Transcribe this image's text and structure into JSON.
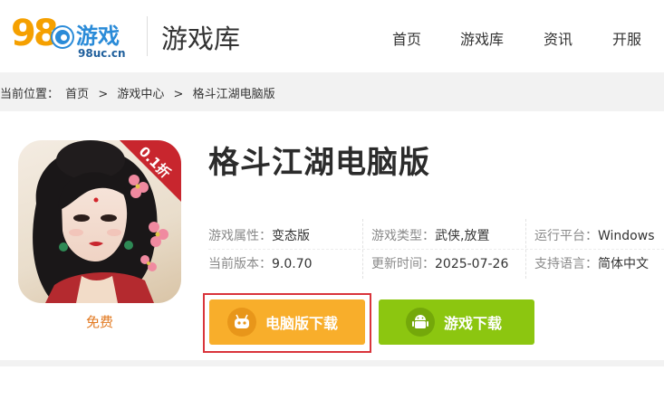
{
  "header": {
    "logo_number": "98",
    "logo_text": "游戏",
    "logo_url": "98uc.cn",
    "section_title": "游戏库",
    "nav": [
      "首页",
      "游戏库",
      "资讯",
      "开服"
    ]
  },
  "breadcrumb": {
    "prefix": "当前位置：",
    "items": [
      "首页",
      "游戏中心",
      "格斗江湖电脑版"
    ],
    "separator": ">"
  },
  "game": {
    "title": "格斗江湖电脑版",
    "badge": "0.1折",
    "price": "免费",
    "info": [
      {
        "label": "游戏属性：",
        "value": "变态版"
      },
      {
        "label": "游戏类型：",
        "value": "武侠,放置"
      },
      {
        "label": "运行平台：",
        "value": "Windows"
      },
      {
        "label": "当前版本：",
        "value": "9.0.70"
      },
      {
        "label": "更新时间：",
        "value": "2025-07-26"
      },
      {
        "label": "支持语言：",
        "value": "简体中文"
      }
    ]
  },
  "buttons": {
    "pc_download": "电脑版下载",
    "game_download": "游戏下载"
  },
  "colors": {
    "pc_button": "#f8ae2b",
    "game_button": "#8cc610",
    "highlight_border": "#d9343b",
    "price": "#e27a22"
  }
}
